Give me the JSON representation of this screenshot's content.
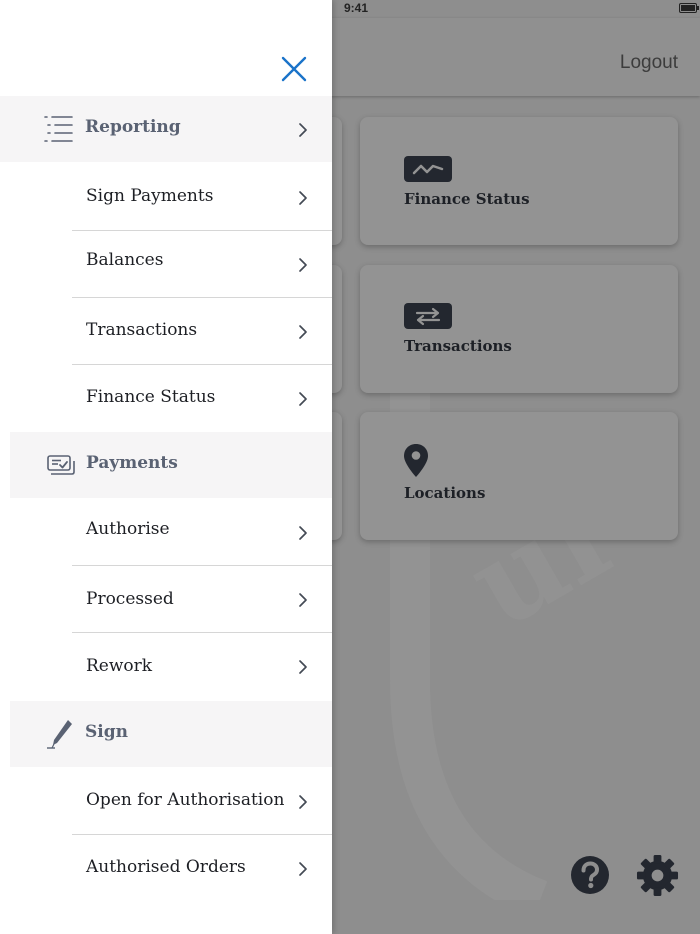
{
  "status_bar": {
    "time": "9:41"
  },
  "header": {
    "logout_label": "Logout"
  },
  "dashboard": {
    "tiles": [
      {
        "label": "Finance Status",
        "icon": "chart-line-icon"
      },
      {
        "label": "Transactions",
        "icon": "swap-arrows-icon"
      },
      {
        "label": "Locations",
        "icon": "map-pin-icon"
      }
    ],
    "bottom_icons": [
      "help-icon",
      "gear-icon"
    ]
  },
  "menu": {
    "sections": [
      {
        "title": "Reporting",
        "icon": "list-icon",
        "items": [
          "Sign Payments",
          "Balances",
          "Transactions",
          "Finance Status"
        ]
      },
      {
        "title": "Payments",
        "icon": "payment-check-icon",
        "items": [
          "Authorise",
          "Processed",
          "Rework"
        ]
      },
      {
        "title": "Sign",
        "icon": "pen-icon",
        "items": [
          "Open for Authorisation",
          "Authorised Orders"
        ]
      }
    ]
  },
  "colors": {
    "accent": "#1a73c9",
    "section_title": "#5a6273",
    "section_bg": "#f6f5f6",
    "overlay": "#8e8e8e",
    "tile_icon": "#23272f"
  }
}
